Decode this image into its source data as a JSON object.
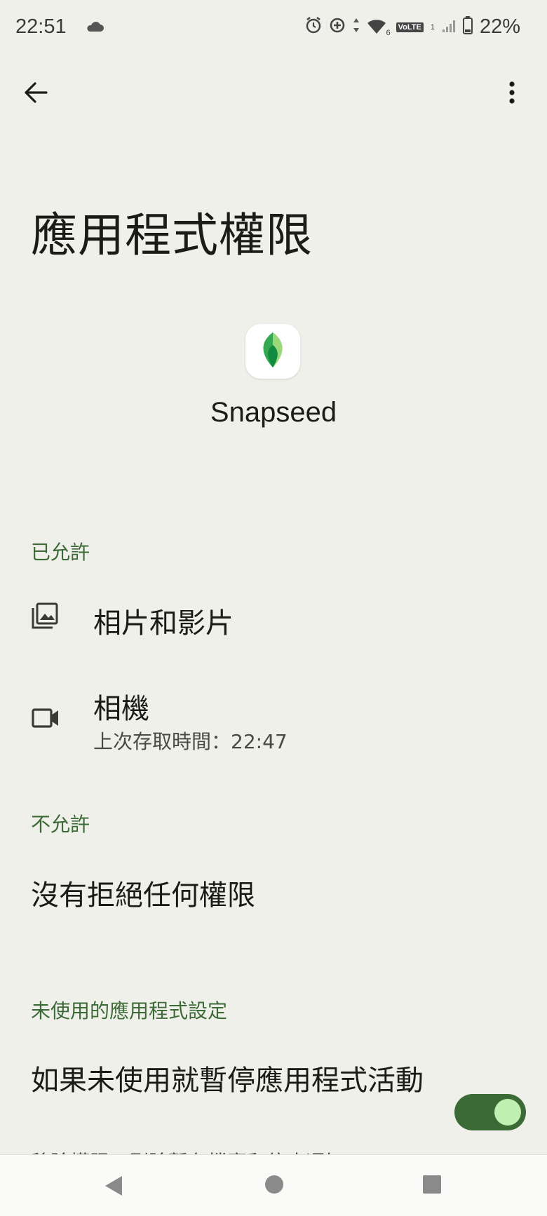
{
  "status_bar": {
    "time": "22:51",
    "battery_text": "22%",
    "network_badge": "VoLTE",
    "signal_slot": "1",
    "wifi_band": "6"
  },
  "app_bar": {
    "back_icon": "arrow-back-icon",
    "menu_icon": "more-vert-icon"
  },
  "page": {
    "title": "應用程式權限",
    "app_name": "Snapseed"
  },
  "allowed": {
    "header": "已允許",
    "items": [
      {
        "label": "相片和影片",
        "icon": "photo-library-icon"
      },
      {
        "label": "相機",
        "sublabel": "上次存取時間：22:47",
        "icon": "videocam-icon"
      }
    ]
  },
  "denied": {
    "header": "不允許",
    "empty_text": "沒有拒絕任何權限"
  },
  "unused": {
    "header": "未使用的應用程式設定",
    "toggle_label": "如果未使用就暫停應用程式活動",
    "toggle_sub": "移除權限、刪除暫存檔案和停止通知",
    "toggle_on": true
  },
  "colors": {
    "background": "#f0f0eb",
    "accent": "#3c6a36",
    "toggle_knob": "#bff0b2"
  }
}
